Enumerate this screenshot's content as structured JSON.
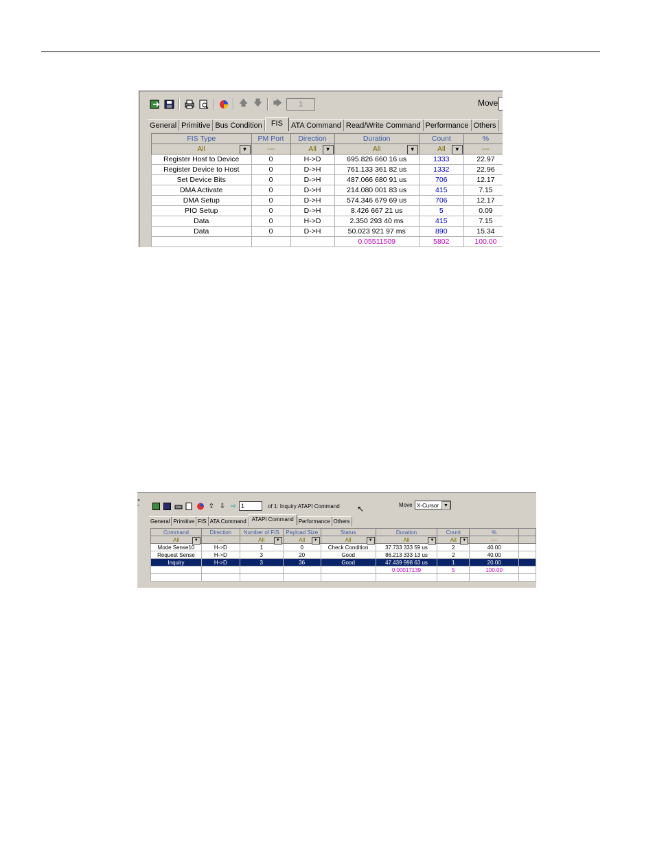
{
  "shot1": {
    "toolbar": {
      "icons": [
        "export-icon",
        "save-icon",
        "print-icon",
        "print-preview-icon",
        "color-icon",
        "arrow-up-icon",
        "arrow-down-icon",
        "arrow-right-icon"
      ],
      "page_value": "1",
      "move_label": "Move"
    },
    "tabs": [
      "General",
      "Primitive",
      "Bus Condition",
      "FIS",
      "ATA Command",
      "Read/Write Command",
      "Performance",
      "Others"
    ],
    "active_tab": "FIS",
    "columns": [
      "FIS Type",
      "PM Port",
      "Direction",
      "Duration",
      "Count",
      "%"
    ],
    "filters": [
      "All",
      "---",
      "All",
      "All",
      "All",
      "---"
    ],
    "rows": [
      [
        "Register Host to Device",
        "0",
        "H->D",
        "695.826 660 16  us",
        "1333",
        "22.97"
      ],
      [
        "Register Device to Host",
        "0",
        "D->H",
        "761.133 361 82  us",
        "1332",
        "22.96"
      ],
      [
        "Set Device Bits",
        "0",
        "D->H",
        "487.066 680 91  us",
        "706",
        "12.17"
      ],
      [
        "DMA Activate",
        "0",
        "D->H",
        "214.080 001 83  us",
        "415",
        "7.15"
      ],
      [
        "DMA Setup",
        "0",
        "D->H",
        "574.346 679 69  us",
        "706",
        "12.17"
      ],
      [
        "PIO Setup",
        "0",
        "D->H",
        "8.426 667 21  us",
        "5",
        "0.09"
      ],
      [
        "Data",
        "0",
        "H->D",
        "2.350 293 40  ms",
        "415",
        "7.15"
      ],
      [
        "Data",
        "0",
        "D->H",
        "50.023 921 97  ms",
        "890",
        "15.34"
      ]
    ],
    "totals": [
      "",
      "",
      "",
      "0.05511509",
      "5802",
      "100.00"
    ],
    "colors": {
      "header_text": "#3b5aa6",
      "count_text": "#0000cc",
      "total_text": "#c000c0",
      "filter_text": "#7a6a00"
    }
  },
  "shot2": {
    "toolbar": {
      "page_value": "1",
      "of_text": "of 1: Inquiry  ATAPI Command",
      "move_label": "Move",
      "move_value": "X-Cursor"
    },
    "tabs": [
      "General",
      "Primitive",
      "FIS",
      "ATA Command",
      "ATAPI Command",
      "Performance",
      "Others"
    ],
    "active_tab": "ATAPI Command",
    "columns": [
      "Command",
      "Direction",
      "Number of FIS",
      "Payload Size",
      "Status",
      "Duration",
      "Count",
      "%",
      ""
    ],
    "filters": [
      "All",
      "---",
      "All",
      "All",
      "All",
      "All",
      "All",
      "---",
      ""
    ],
    "rows": [
      [
        "Mode Sense10",
        "H->D",
        "1",
        "0",
        "Check Condition",
        "37.733 333 59  us",
        "2",
        "40.00",
        ""
      ],
      [
        "Request Sense",
        "H->D",
        "3",
        "20",
        "Good",
        "86.213 333 13  us",
        "2",
        "40.00",
        ""
      ],
      [
        "Inquiry",
        "H->D",
        "3",
        "36",
        "Good",
        "47.439 998 63  us",
        "1",
        "20.00",
        ""
      ]
    ],
    "totals": [
      "",
      "",
      "",
      "",
      "",
      "0.00017139",
      "5",
      "100.00",
      ""
    ],
    "selected_row": 2,
    "colors": {
      "selection_bg": "#0a246a"
    }
  }
}
